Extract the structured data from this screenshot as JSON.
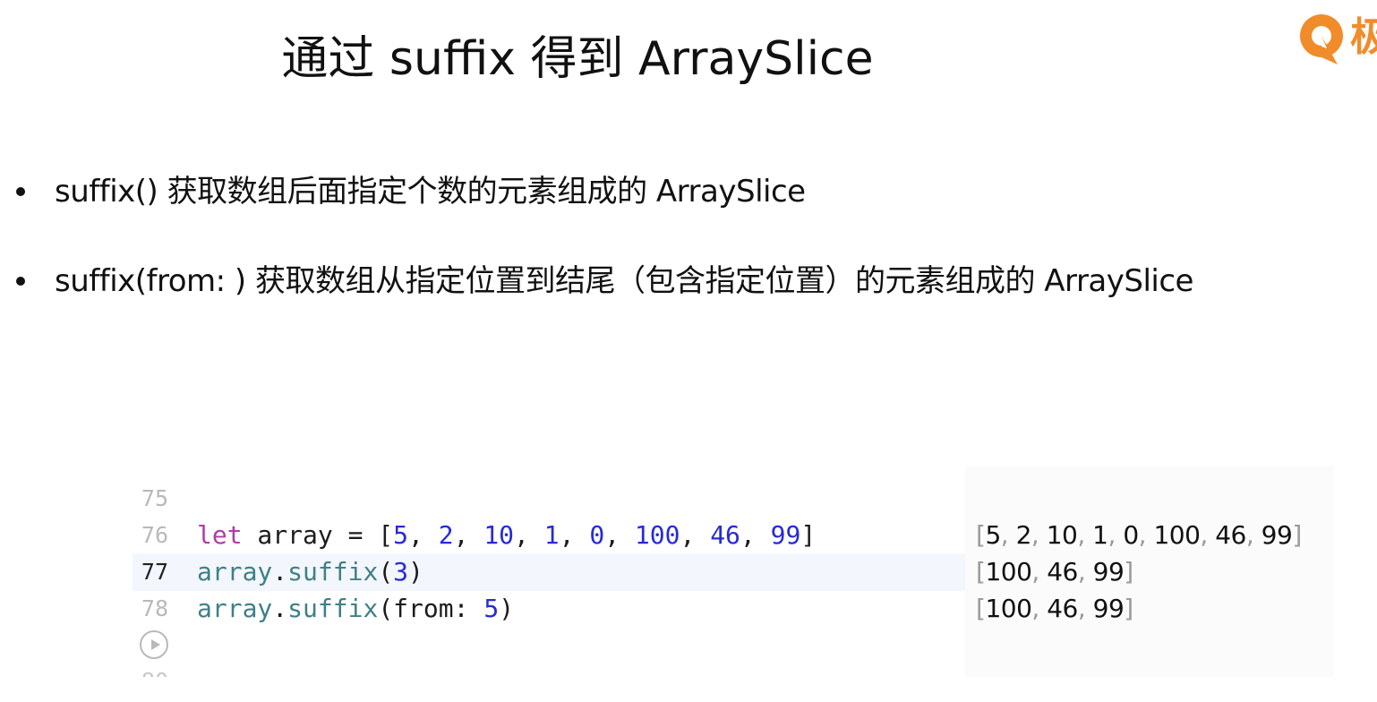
{
  "slide": {
    "title": "通过 suffix 得到 ArraySlice"
  },
  "logo": {
    "icon": "brand-logo-icon",
    "char": "极",
    "color": "#f08c2a"
  },
  "bullets": [
    {
      "text": "suffix() 获取数组后面指定个数的元素组成的 ArraySlice"
    },
    {
      "text": "suffix(from: ) 获取数组从指定位置到结尾（包含指定位置）的元素组成的 ArraySlice"
    }
  ],
  "editor": {
    "lines": [
      {
        "number": "75",
        "tokens": []
      },
      {
        "number": "76",
        "tokens": [
          {
            "t": "let",
            "k": "kw"
          },
          {
            "t": " array = [",
            "k": "plain"
          },
          {
            "t": "5",
            "k": "num"
          },
          {
            "t": ", ",
            "k": "plain"
          },
          {
            "t": "2",
            "k": "num"
          },
          {
            "t": ", ",
            "k": "plain"
          },
          {
            "t": "10",
            "k": "num"
          },
          {
            "t": ", ",
            "k": "plain"
          },
          {
            "t": "1",
            "k": "num"
          },
          {
            "t": ", ",
            "k": "plain"
          },
          {
            "t": "0",
            "k": "num"
          },
          {
            "t": ", ",
            "k": "plain"
          },
          {
            "t": "100",
            "k": "num"
          },
          {
            "t": ", ",
            "k": "plain"
          },
          {
            "t": "46",
            "k": "num"
          },
          {
            "t": ", ",
            "k": "plain"
          },
          {
            "t": "99",
            "k": "num"
          },
          {
            "t": "]",
            "k": "plain"
          }
        ],
        "result": [
          "5",
          "2",
          "10",
          "1",
          "0",
          "100",
          "46",
          "99"
        ]
      },
      {
        "number": "77",
        "current": true,
        "tokens": [
          {
            "t": "array",
            "k": "ident"
          },
          {
            "t": ".",
            "k": "plain"
          },
          {
            "t": "suffix",
            "k": "ident"
          },
          {
            "t": "(",
            "k": "plain"
          },
          {
            "t": "3",
            "k": "num"
          },
          {
            "t": ")",
            "k": "plain"
          }
        ],
        "result": [
          "100",
          "46",
          "99"
        ]
      },
      {
        "number": "78",
        "tokens": [
          {
            "t": "array",
            "k": "ident"
          },
          {
            "t": ".",
            "k": "plain"
          },
          {
            "t": "suffix",
            "k": "ident"
          },
          {
            "t": "(from: ",
            "k": "plain"
          },
          {
            "t": "5",
            "k": "num"
          },
          {
            "t": ")",
            "k": "plain"
          }
        ],
        "result": [
          "100",
          "46",
          "99"
        ]
      }
    ],
    "colors": {
      "keyword": "#ad3da4",
      "number": "#272ad8",
      "identifier": "#3e8087",
      "current_line_bg": "#f3f7fd"
    },
    "run_icon": "play-icon"
  }
}
